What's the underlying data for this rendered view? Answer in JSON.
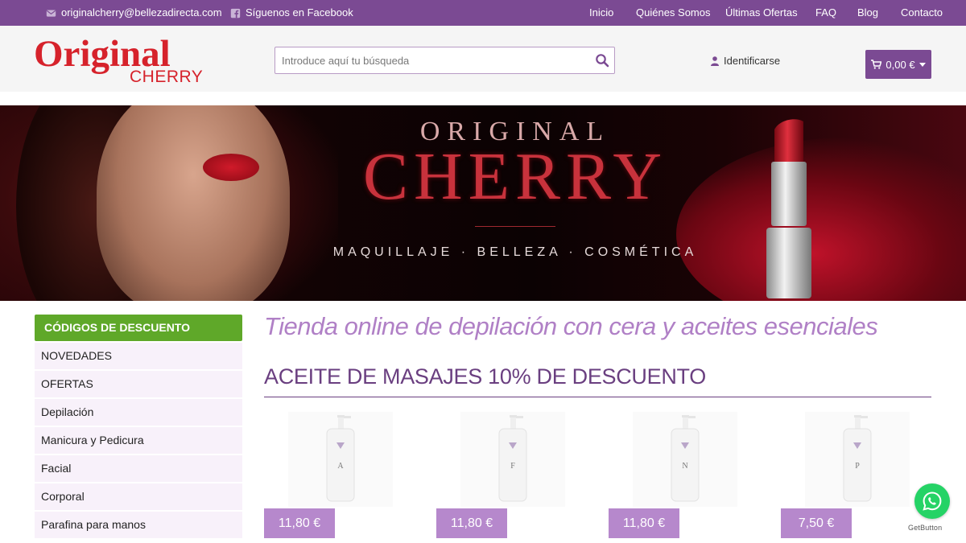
{
  "topbar": {
    "email": "originalcherry@bellezadirecta.com",
    "facebook": "Síguenos en Facebook",
    "nav": [
      "Inicio",
      "Quiénes Somos",
      "Últimas Ofertas",
      "FAQ",
      "Blog",
      "Contacto"
    ]
  },
  "header": {
    "logo_big": "Original",
    "logo_small": "CHERRY",
    "search_placeholder": "Introduce aquí tu búsqueda",
    "login_label": "Identificarse",
    "cart_total": "0,00 €"
  },
  "banner": {
    "line1": "ORIGINAL",
    "line2": "CHERRY",
    "line3": "MAQUILLAJE · BELLEZA · COSMÉTICA"
  },
  "sidebar": {
    "header": "CÓDIGOS DE DESCUENTO",
    "items": [
      "NOVEDADES",
      "OFERTAS",
      "Depilación",
      "Manicura y Pedicura",
      "Facial",
      "Corporal",
      "Parafina para manos"
    ]
  },
  "main": {
    "tagline": "Tienda online de depilación con cera y aceites esenciales",
    "section_title": "ACEITE DE MASAJES 10% DE DESCUENTO",
    "products": [
      {
        "letter": "A",
        "price": "11,80 €"
      },
      {
        "letter": "F",
        "price": "11,80 €"
      },
      {
        "letter": "N",
        "price": "11,80 €"
      },
      {
        "letter": "P",
        "price": "7,50 €"
      }
    ]
  },
  "widgets": {
    "getbutton": "GetButton"
  },
  "colors": {
    "brand_purple": "#7b4a93",
    "logo_red": "#d6222b",
    "discount_green": "#5fa829",
    "price_purple": "#b688cc",
    "whatsapp_green": "#25d366"
  },
  "icons": [
    "envelope-icon",
    "facebook-icon",
    "search-icon",
    "user-icon",
    "cart-icon",
    "caret-down-icon",
    "whatsapp-icon"
  ]
}
